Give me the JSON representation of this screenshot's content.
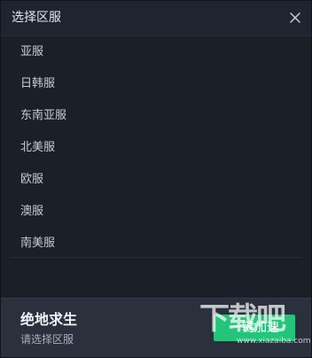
{
  "dialog": {
    "title": "选择区服",
    "close_icon": "close-icon"
  },
  "regions": [
    {
      "label": "亚服"
    },
    {
      "label": "日韩服"
    },
    {
      "label": "东南亚服"
    },
    {
      "label": "北美服"
    },
    {
      "label": "欧服"
    },
    {
      "label": "澳服"
    },
    {
      "label": "南美服"
    }
  ],
  "footer": {
    "game_name": "绝地求生",
    "status": "请选择区服",
    "boost_label": "一键加速"
  },
  "watermark": {
    "text": "下载吧",
    "url": "www.xiazaiba.com"
  },
  "colors": {
    "background": "#1b1f28",
    "accent": "#24c47b",
    "footer": "#2a303c"
  }
}
